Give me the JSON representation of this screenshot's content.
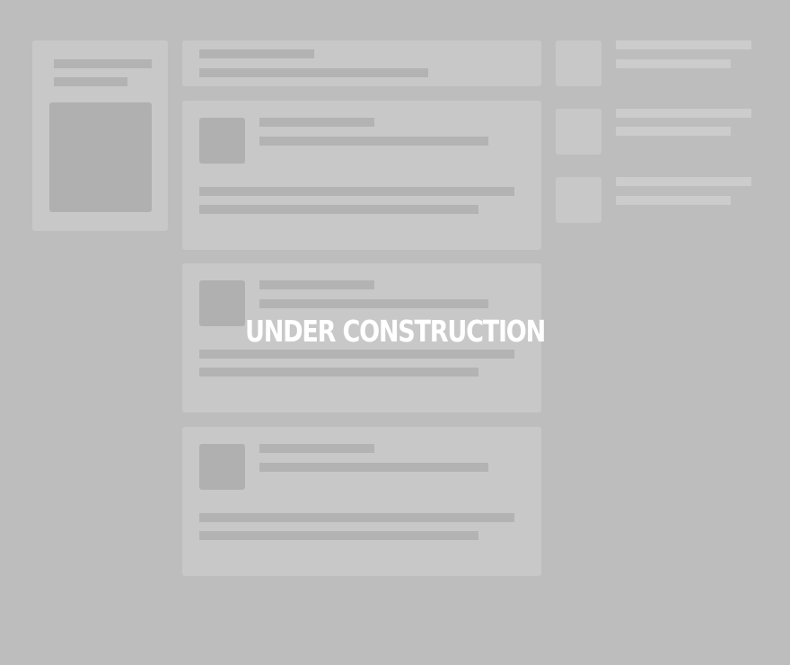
{
  "overlay": {
    "message": "UNDER CONSTRUCTION"
  },
  "skeleton": {
    "profile_card": {
      "placeholder_lines": 2,
      "has_image": true
    },
    "composer_card": {
      "placeholder_lines": 2
    },
    "feed_posts": [
      {
        "avatar": true,
        "header_lines": 2,
        "body_lines": 2
      },
      {
        "avatar": true,
        "header_lines": 2,
        "body_lines": 2
      },
      {
        "avatar": true,
        "header_lines": 2,
        "body_lines": 2
      }
    ],
    "suggestions": [
      {
        "thumbnail": true,
        "lines": 2
      },
      {
        "thumbnail": true,
        "lines": 2
      },
      {
        "thumbnail": true,
        "lines": 2
      }
    ],
    "colors": {
      "background": "#bdbdbd",
      "card": "#c8c8c8",
      "placeholder": "#b3b3b3",
      "overlay_text": "#ffffff"
    }
  }
}
